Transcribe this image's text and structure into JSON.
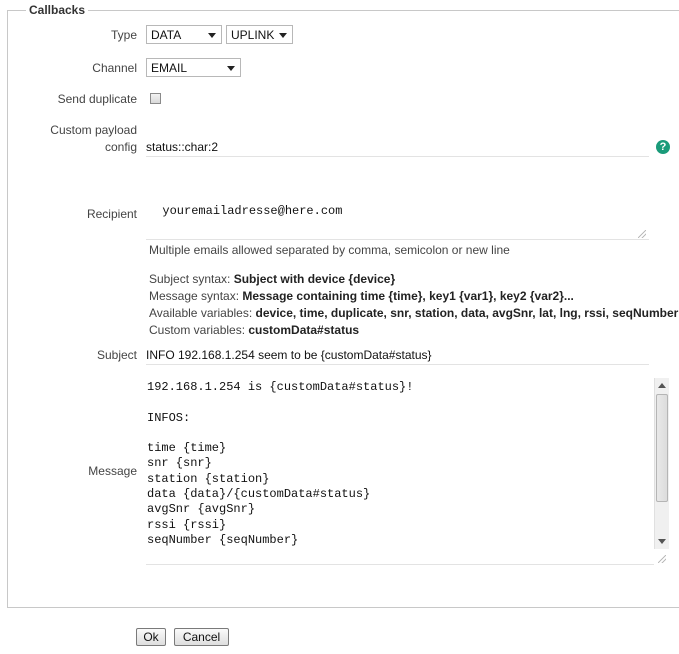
{
  "legend": "Callbacks",
  "type": {
    "label": "Type",
    "value": "DATA",
    "direction": "UPLINK"
  },
  "channel": {
    "label": "Channel",
    "value": "EMAIL"
  },
  "send_duplicate": {
    "label": "Send duplicate",
    "checked": false
  },
  "payload": {
    "label_line1": "Custom payload",
    "label_line2": "config",
    "value": "status::char:2",
    "help_icon": "?"
  },
  "recipient": {
    "label": "Recipient",
    "value": "youremailadresse@here.com"
  },
  "help": {
    "emails_note": "Multiple emails allowed separated by comma, semicolon or new line",
    "subject_prefix": "Subject syntax: ",
    "subject_value": "Subject with device {device}",
    "message_prefix": "Message syntax: ",
    "message_value": "Message containing time {time}, key1 {var1}, key2 {var2}...",
    "available_prefix": "Available variables: ",
    "available_value": "device, time, duplicate, snr, station, data, avgSnr, lat, lng, rssi, seqNumber",
    "custom_prefix": "Custom variables: ",
    "custom_value": "customData#status"
  },
  "subject": {
    "label": "Subject",
    "value": "INFO 192.168.1.254 seem to be {customData#status}"
  },
  "message": {
    "label": "Message",
    "lines": [
      "192.168.1.254 is {customData#status}!",
      "",
      "INFOS:",
      "",
      "time {time}",
      "snr {snr}",
      "station {station}",
      "data {data}/{customData#status}",
      "avgSnr {avgSnr}",
      "rssi {rssi}",
      "seqNumber {seqNumber}"
    ]
  },
  "buttons": {
    "ok": "Ok",
    "cancel": "Cancel"
  }
}
